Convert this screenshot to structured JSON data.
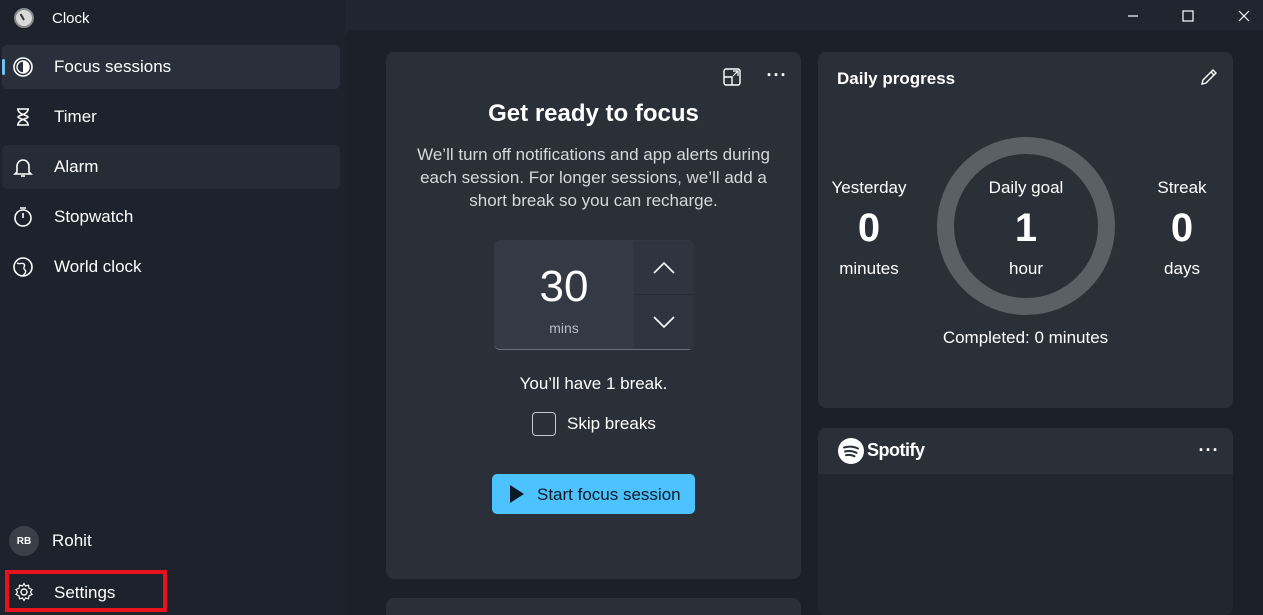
{
  "window": {
    "title": "Clock",
    "controls": {
      "minimize": "—",
      "maximize": "☐",
      "close": "✕"
    }
  },
  "sidebar": {
    "items": [
      {
        "label": "Focus sessions",
        "icon": "focus-icon",
        "selected": true
      },
      {
        "label": "Timer",
        "icon": "hourglass-icon"
      },
      {
        "label": "Alarm",
        "icon": "bell-icon"
      },
      {
        "label": "Stopwatch",
        "icon": "stopwatch-icon"
      },
      {
        "label": "World clock",
        "icon": "globe-icon"
      }
    ],
    "user": {
      "initials": "RB",
      "name": "Rohit"
    },
    "settings_label": "Settings"
  },
  "focus": {
    "title": "Get ready to focus",
    "description": "We’ll turn off notifications and app alerts during each session. For longer sessions, we’ll add a short break so you can recharge.",
    "duration_value": "30",
    "duration_unit": "mins",
    "break_text": "You’ll have 1 break.",
    "skip_breaks_label": "Skip breaks",
    "skip_breaks_checked": false,
    "start_label": "Start focus session",
    "accent": "#4cc2ff"
  },
  "progress": {
    "title": "Daily progress",
    "yesterday": {
      "label": "Yesterday",
      "value": "0",
      "unit": "minutes"
    },
    "goal": {
      "label": "Daily goal",
      "value": "1",
      "unit": "hour"
    },
    "streak": {
      "label": "Streak",
      "value": "0",
      "unit": "days"
    },
    "completed": "Completed: 0 minutes"
  },
  "spotify": {
    "name": "Spotify"
  }
}
